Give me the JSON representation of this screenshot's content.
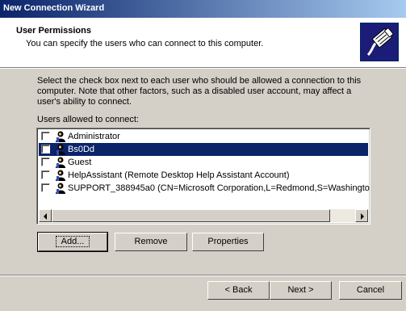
{
  "window": {
    "title": "New Connection Wizard"
  },
  "header": {
    "title": "User Permissions",
    "subtitle": "You can specify the users who can connect to this computer.",
    "icon": "network-cable-plug-icon"
  },
  "description": "Select the check box next to each user who should be allowed a connection to this computer.  Note that other factors, such as a disabled user account, may affect a user's ability to connect.",
  "users_label": "Users allowed to connect:",
  "users": [
    {
      "name": "Administrator",
      "checked": false,
      "selected": false
    },
    {
      "name": "Bs0Dd",
      "checked": false,
      "selected": true
    },
    {
      "name": "Guest",
      "checked": false,
      "selected": false
    },
    {
      "name": "HelpAssistant (Remote Desktop Help Assistant Account)",
      "checked": false,
      "selected": false
    },
    {
      "name": "SUPPORT_388945a0 (CN=Microsoft Corporation,L=Redmond,S=Washington,C",
      "checked": false,
      "selected": false
    }
  ],
  "list_buttons": {
    "add": "Add...",
    "remove": "Remove",
    "properties": "Properties"
  },
  "nav_buttons": {
    "back": "< Back",
    "next": "Next >",
    "cancel": "Cancel"
  }
}
